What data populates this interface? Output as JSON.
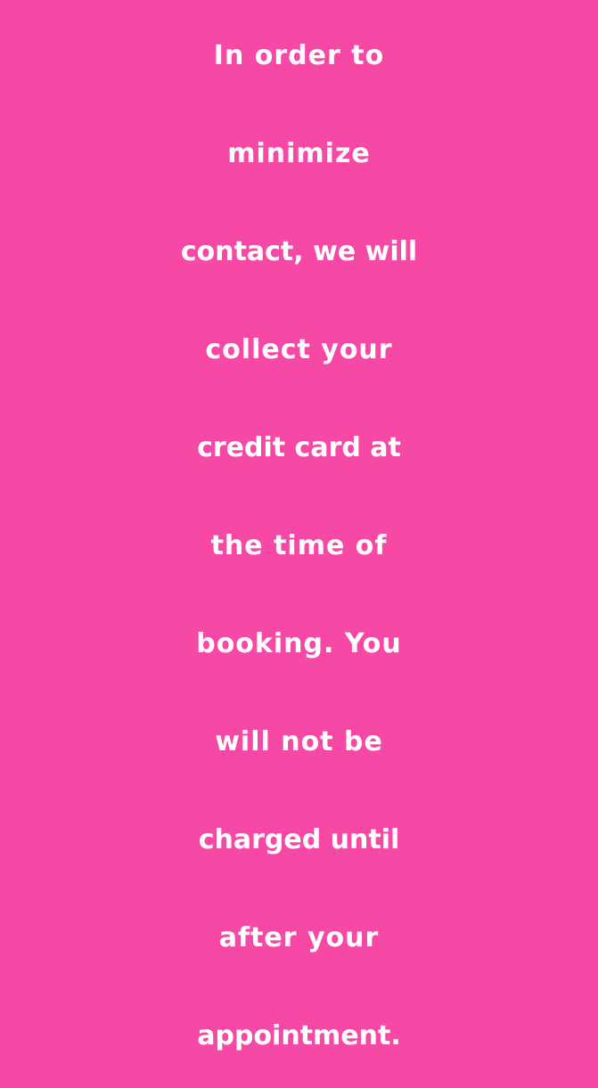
{
  "background_color": "#f549a5",
  "text_color": "#ffffff",
  "message": {
    "lines": [
      "In order to",
      "minimize",
      "contact, we will",
      "collect your",
      "credit card at",
      "the time of",
      "booking. You",
      "will not be",
      "charged until",
      "after your",
      "appointment."
    ]
  }
}
